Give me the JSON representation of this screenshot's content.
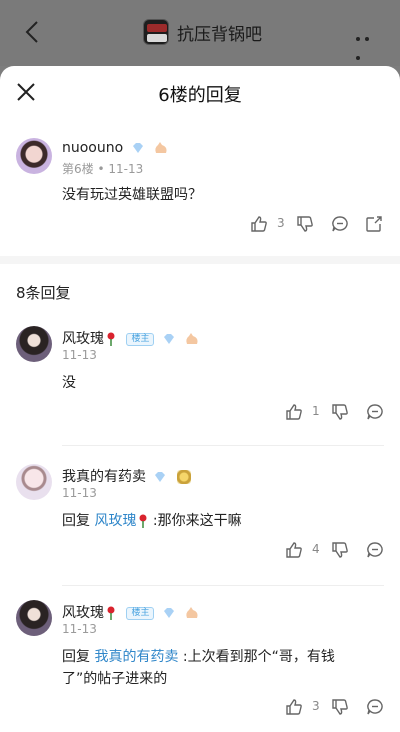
{
  "topbar": {
    "forum_name": "抗压背锅吧"
  },
  "sheet": {
    "title": "6楼的回复"
  },
  "main_post": {
    "username": "nuoouno",
    "floor": "第6楼",
    "dot": "•",
    "date": "11-13",
    "text": "没有玩过英雄联盟吗？",
    "likes": "3"
  },
  "replies_header": "8条回复",
  "replies": [
    {
      "username": "风玫瑰",
      "badge": "楼主",
      "date": "11-13",
      "text": "没",
      "likes": "1"
    },
    {
      "username": "我真的有药卖",
      "date": "11-13",
      "prefix": "回复",
      "target": "风玫瑰",
      "text": ":那你来这干嘛",
      "likes": "4"
    },
    {
      "username": "风玫瑰",
      "badge": "楼主",
      "date": "11-13",
      "prefix": "回复",
      "target": "我真的有药卖",
      "text_line1": ":上次看到那个“哥，有钱",
      "text_line2": "了”的帖子进来的",
      "likes": "3"
    }
  ],
  "colors": {
    "link": "#2f86c9",
    "muted": "#9a9a9a",
    "overlay": "#7d7d7d"
  }
}
